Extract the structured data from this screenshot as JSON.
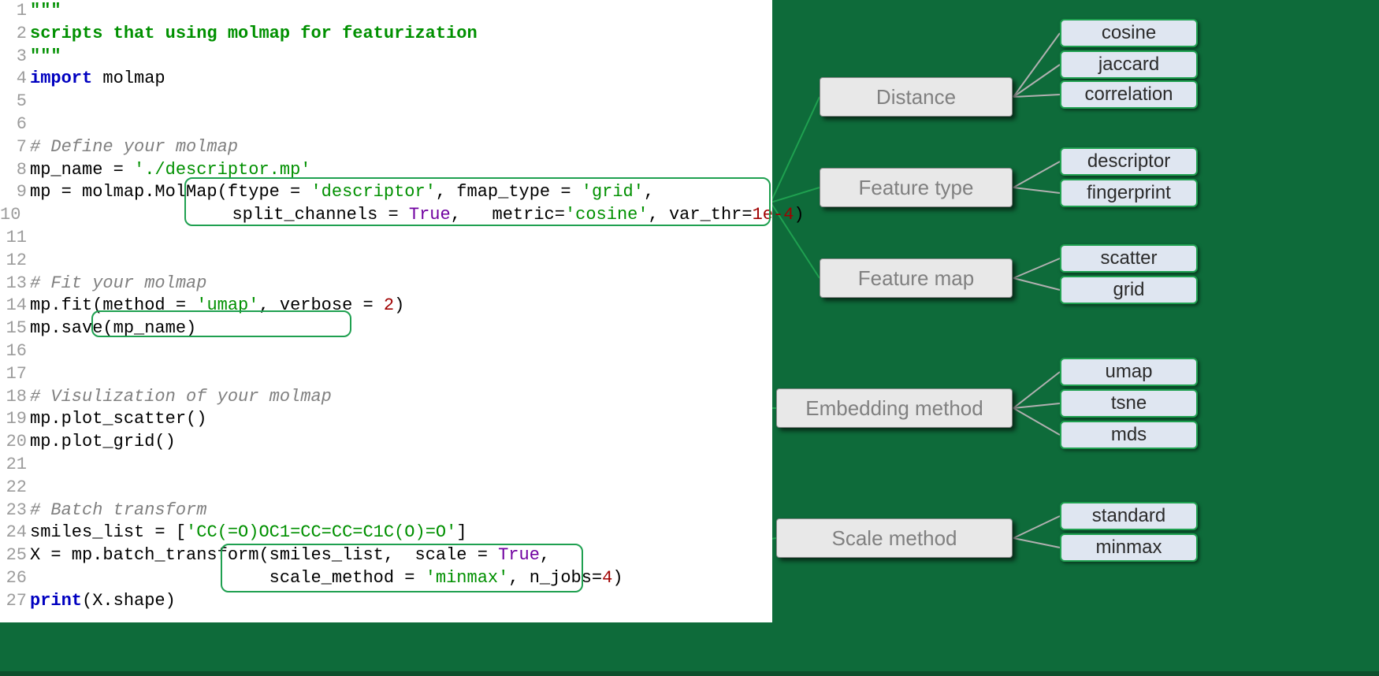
{
  "gutter": [
    "1",
    "2",
    "3",
    "4",
    "5",
    "6",
    "7",
    "8",
    "9",
    "10",
    "11",
    "12",
    "13",
    "14",
    "15",
    "16",
    "17",
    "18",
    "19",
    "20",
    "21",
    "22",
    "23",
    "24",
    "25",
    "26",
    "27"
  ],
  "code": {
    "l1": "\"\"\"",
    "l2": "scripts that using molmap for featurization",
    "l3": "\"\"\"",
    "l4a": "import",
    "l4b": " molmap",
    "l7": "# Define your molmap",
    "l8a": "mp_name = ",
    "l8b": "'./descriptor.mp'",
    "l9a": "mp = molmap.MolMap",
    "l9b": "(ftype = ",
    "l9c": "'descriptor'",
    "l9d": ", fmap_type = ",
    "l9e": "'grid'",
    "l9f": ",",
    "l10a": "                    split_channels = ",
    "l10b": "True",
    "l10c": ",   metric=",
    "l10d": "'cosine'",
    "l10e": ", var_thr=",
    "l10f": "1e-4",
    "l10g": ")",
    "l13": "# Fit your molmap",
    "l14a": "mp.fit",
    "l14b": "(method = ",
    "l14c": "'umap'",
    "l14d": ", verbose = ",
    "l14e": "2",
    "l14f": ")",
    "l15": "mp.save(mp_name)",
    "l18": "# Visulization of your molmap",
    "l19": "mp.plot_scatter()",
    "l20": "mp.plot_grid()",
    "l23": "# Batch transform",
    "l24a": "smiles_list = [",
    "l24b": "'CC(=O)OC1=CC=CC=C1C(O)=O'",
    "l24c": "]",
    "l25a": "X = mp.batch_transform",
    "l25b": "(smiles_list,  scale = ",
    "l25c": "True",
    "l25d": ",",
    "l26a": "                       scale_method = ",
    "l26b": "'minmax'",
    "l26c": ", n_jobs=",
    "l26d": "4",
    "l26e": ")",
    "l27a": "print",
    "l27b": "(X.shape)"
  },
  "categories": {
    "distance": "Distance",
    "feature_type": "Feature type",
    "feature_map": "Feature map",
    "embedding": "Embedding method",
    "scale": "Scale method"
  },
  "options": {
    "distance": [
      "cosine",
      "jaccard",
      "correlation"
    ],
    "feature_type": [
      "descriptor",
      "fingerprint"
    ],
    "feature_map": [
      "scatter",
      "grid"
    ],
    "embedding": [
      "umap",
      "tsne",
      "mds"
    ],
    "scale": [
      "standard",
      "minmax"
    ]
  }
}
